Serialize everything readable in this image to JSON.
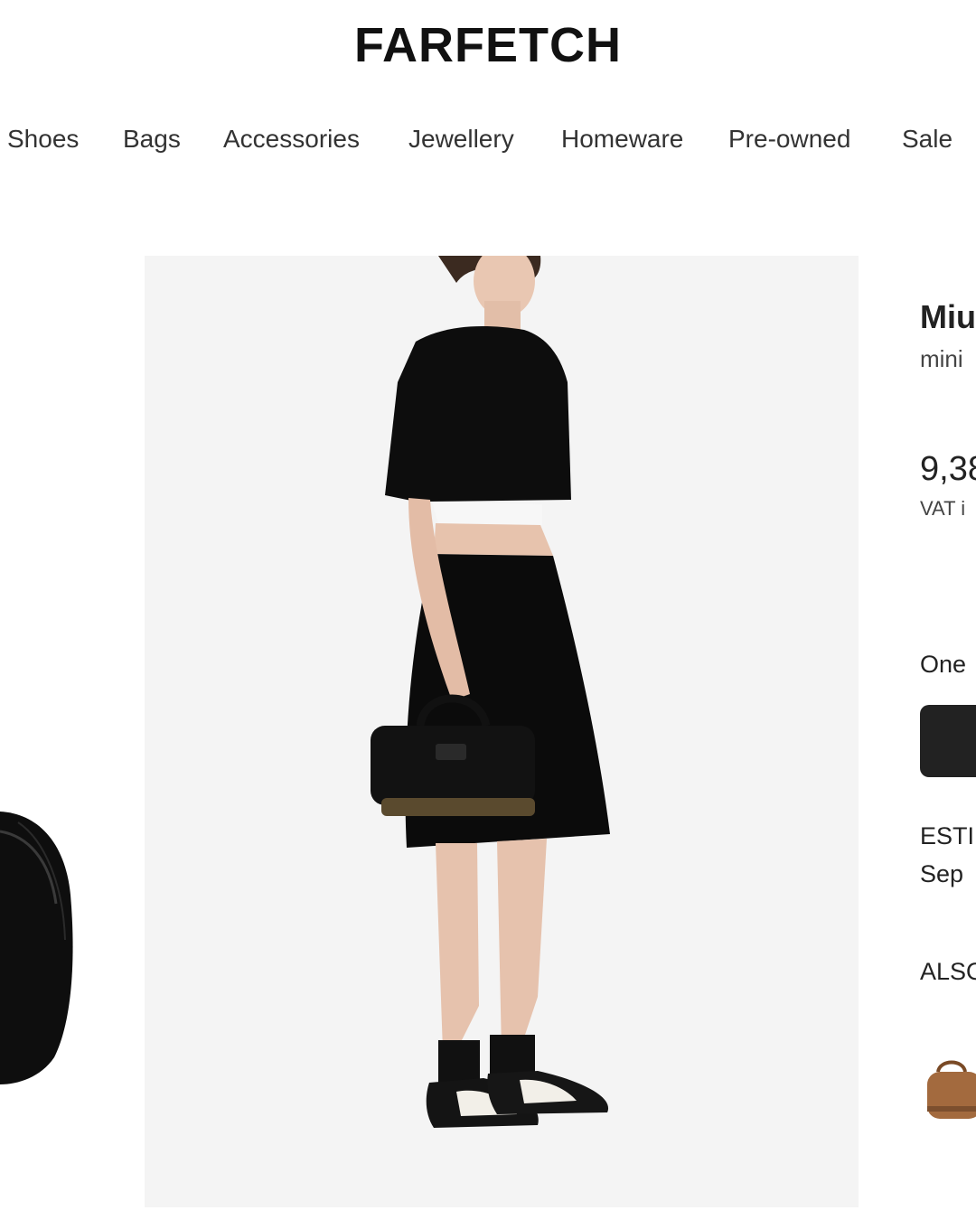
{
  "header": {
    "logo": "FARFETCH"
  },
  "nav": {
    "items": [
      {
        "label": "Shoes"
      },
      {
        "label": "Bags"
      },
      {
        "label": "Accessories"
      },
      {
        "label": "Jewellery"
      },
      {
        "label": "Homeware"
      },
      {
        "label": "Pre-owned"
      },
      {
        "label": "Sale"
      }
    ]
  },
  "product": {
    "brand": "Miu",
    "description": "mini",
    "price": "9,38",
    "vat_note": "VAT i",
    "size_label": "One",
    "delivery_title": "ESTI",
    "delivery_date": "Sep",
    "also_label": "ALSO"
  }
}
